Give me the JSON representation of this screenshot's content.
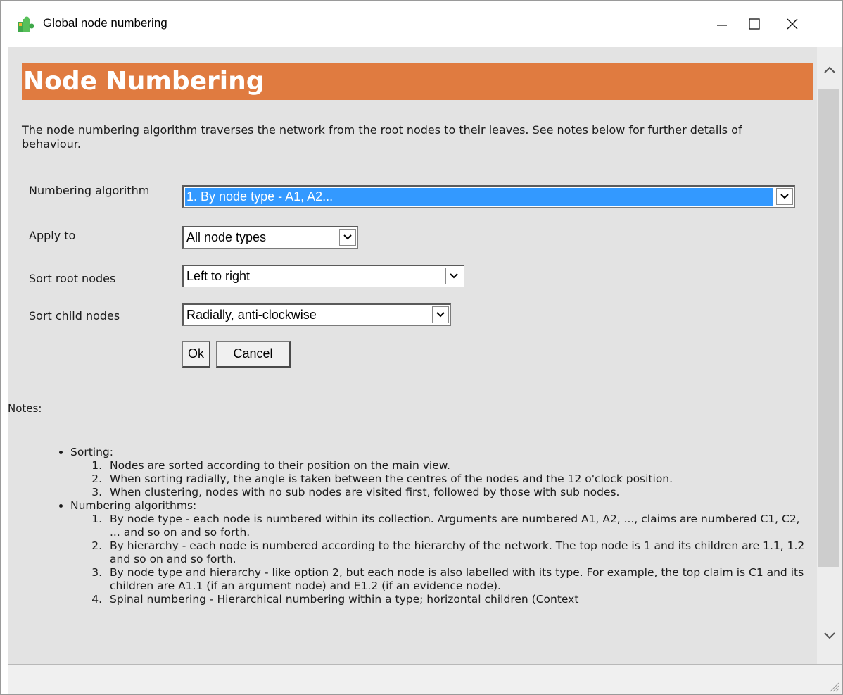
{
  "window": {
    "title": "Global node numbering",
    "controls": {
      "minimize": "minimize-icon",
      "maximize": "maximize-icon",
      "close": "close-icon"
    }
  },
  "page": {
    "heading": "Node Numbering",
    "intro": "The node numbering algorithm traverses the network from the root nodes to their leaves. See notes below for further details of behaviour."
  },
  "form": {
    "algorithm": {
      "label": "Numbering algorithm",
      "value": "1. By node type - A1, A2..."
    },
    "apply_to": {
      "label": "Apply to",
      "value": "All node types"
    },
    "sort_root": {
      "label": "Sort root nodes",
      "value": "Left to right"
    },
    "sort_child": {
      "label": "Sort child nodes",
      "value": "Radially, anti-clockwise"
    },
    "ok_label": "Ok",
    "cancel_label": "Cancel"
  },
  "notes": {
    "label": "Notes:",
    "sections": [
      {
        "title": "Sorting:",
        "items": [
          "Nodes are sorted according to their position on the main view.",
          "When sorting radially, the angle is taken between the centres of the nodes and the 12 o'clock position.",
          "When clustering, nodes with no sub nodes are visited first, followed by those with sub nodes."
        ]
      },
      {
        "title": "Numbering algorithms:",
        "items": [
          "By node type - each node is numbered within its collection. Arguments are numbered A1, A2, ..., claims are numbered C1, C2, ... and so on and so forth.",
          "By hierarchy - each node is numbered according to the hierarchy of the network. The top node is 1 and its children are 1.1, 1.2 and so on and so forth.",
          "By node type and hierarchy - like option 2, but each node is also labelled with its type. For example, the top claim is C1 and its children are A1.1 (if an argument node) and E1.2 (if an evidence node).",
          "Spinal numbering - Hierarchical numbering within a type; horizontal children (Context"
        ]
      }
    ]
  },
  "colors": {
    "heading_bg": "#e07b40",
    "selection": "#3399ff",
    "panel_bg": "#e3e3e3"
  }
}
